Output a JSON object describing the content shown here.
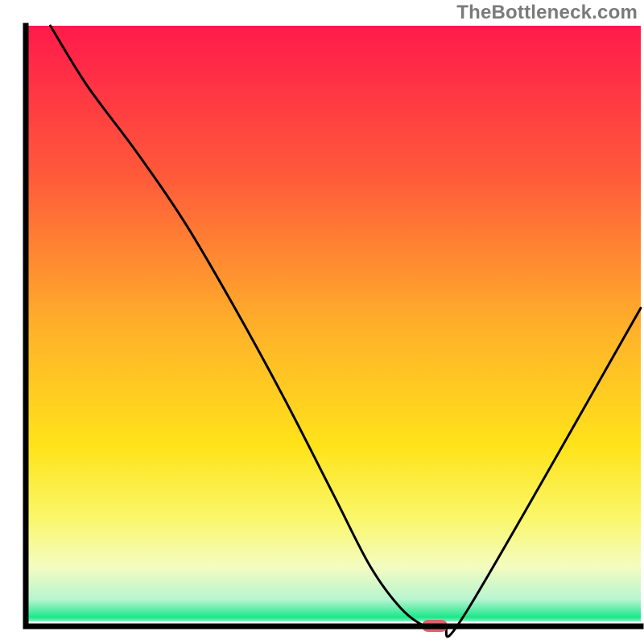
{
  "watermark": "TheBottleneck.com",
  "chart_data": {
    "type": "line",
    "title": "",
    "xlabel": "",
    "ylabel": "",
    "xlim": [
      0,
      100
    ],
    "ylim": [
      0,
      100
    ],
    "series": [
      {
        "name": "bottleneck-curve",
        "x": [
          4,
          10,
          18,
          26,
          34,
          42,
          50,
          56,
          61,
          65,
          68,
          72,
          100
        ],
        "y": [
          100,
          90,
          79,
          67,
          53,
          38,
          22,
          10,
          3,
          0,
          0,
          3,
          53
        ]
      }
    ],
    "marker": {
      "x": 66.5,
      "y": 0
    },
    "background_gradient": {
      "stops": [
        {
          "offset": 0.0,
          "color": "#ff1a4b"
        },
        {
          "offset": 0.25,
          "color": "#ff5a3a"
        },
        {
          "offset": 0.5,
          "color": "#ffb02a"
        },
        {
          "offset": 0.7,
          "color": "#ffe31a"
        },
        {
          "offset": 0.82,
          "color": "#faf76a"
        },
        {
          "offset": 0.9,
          "color": "#f4fcc0"
        },
        {
          "offset": 0.955,
          "color": "#b8f5d0"
        },
        {
          "offset": 0.985,
          "color": "#1ae88a"
        },
        {
          "offset": 1.0,
          "color": "#ffffff"
        }
      ]
    },
    "marker_color": "#d9646b",
    "axis_color": "#000000"
  }
}
